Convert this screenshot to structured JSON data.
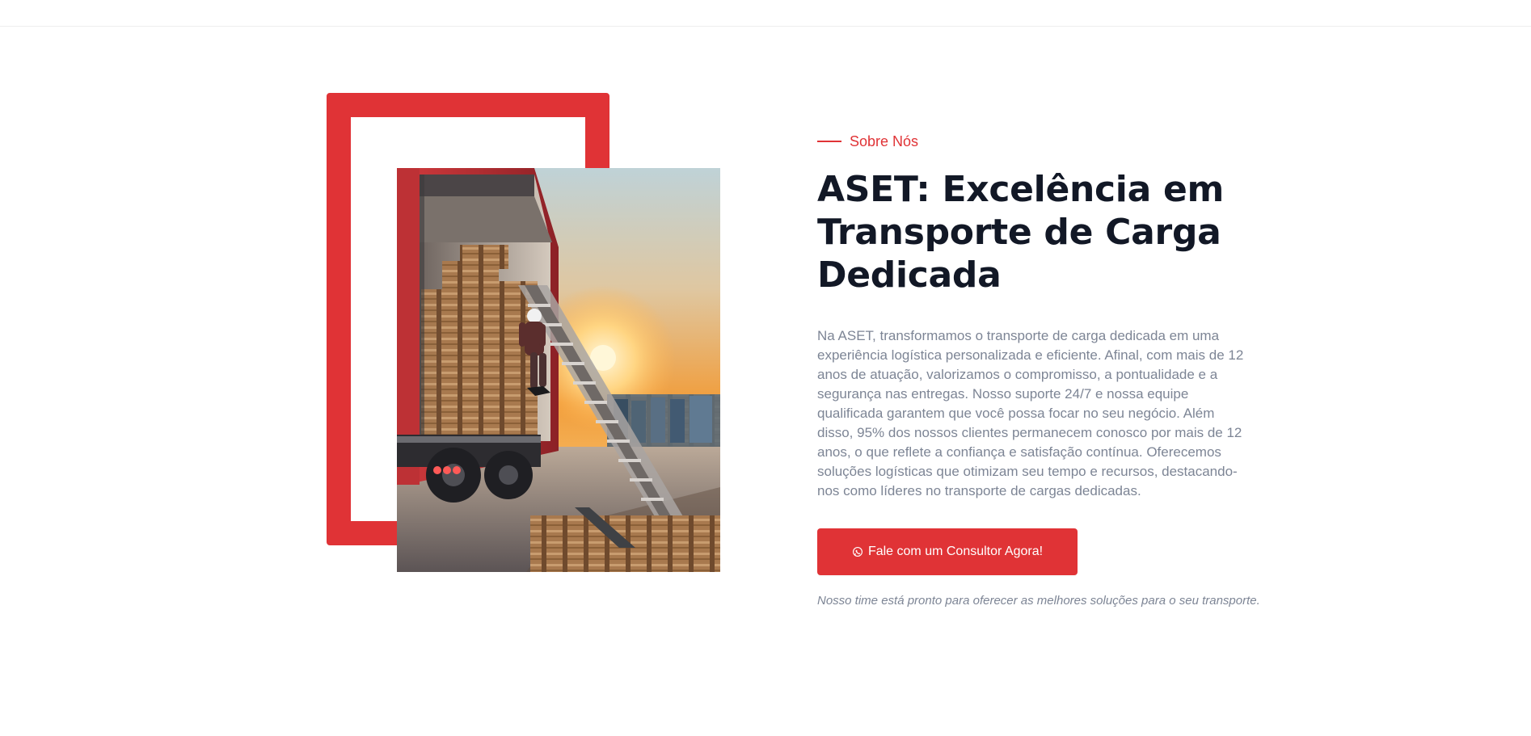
{
  "about": {
    "eyebrow": "Sobre Nós",
    "title": "ASET: Excelência em Transporte de Carga Dedicada",
    "paragraph": "Na ASET, transformamos o transporte de carga dedicada em uma experiência logística personalizada e eficiente. Afinal, com mais de 12 anos de atuação, valorizamos o compromisso, a pontualidade e a segurança nas entregas. Nosso suporte 24/7 e nossa equipe qualificada garantem que você possa focar no seu negócio. Além disso, 95% dos nossos clientes permanecem conosco por mais de 12 anos, o que reflete a confiança e satisfação contínua. Oferecemos soluções logísticas que otimizam seu tempo e recursos, destacando-nos como líderes no transporte de cargas dedicadas.",
    "button_label": "Fale com um Consultor Agora!",
    "button_icon": "whatsapp-icon",
    "note": "Nosso time está pronto para oferecer as melhores soluções para o seu transporte."
  },
  "colors": {
    "accent": "#e03336",
    "heading": "#121826",
    "body_text": "#7d8595"
  }
}
